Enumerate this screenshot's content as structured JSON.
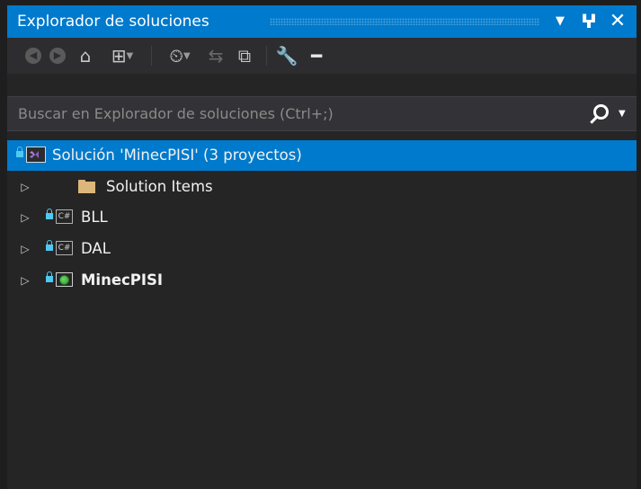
{
  "window": {
    "title": "Explorador de soluciones",
    "dropdown_icon": "caret-down-icon",
    "pin_icon": "pin-icon",
    "close_icon": "close-icon"
  },
  "toolbar": {
    "buttons": [
      {
        "name": "back-button",
        "icon": "back-icon",
        "enabled": false
      },
      {
        "name": "forward-button",
        "icon": "forward-icon",
        "enabled": false
      },
      {
        "name": "home-button",
        "icon": "home-icon",
        "enabled": true
      },
      {
        "name": "switch-views-button",
        "icon": "switch-views-icon",
        "enabled": true,
        "has_dropdown": true
      },
      {
        "name": "pending-changes-filter-button",
        "icon": "pending-changes-icon",
        "enabled": true,
        "has_dropdown": true
      },
      {
        "name": "sync-with-active-document-button",
        "icon": "sync-icon",
        "enabled": false
      },
      {
        "name": "collapse-all-button",
        "icon": "collapse-all-icon",
        "enabled": true
      },
      {
        "name": "properties-button",
        "icon": "wrench-icon",
        "enabled": true
      },
      {
        "name": "preview-selected-items-button",
        "icon": "dash-icon",
        "enabled": true
      }
    ]
  },
  "search": {
    "placeholder": "Buscar en Explorador de soluciones (Ctrl+;)",
    "value": "",
    "icon": "search-icon",
    "options_icon": "caret-down-icon"
  },
  "tree": {
    "solution": {
      "label": "Solución 'MinecPISI'  (3 proyectos)",
      "icon": "solution-icon",
      "selected": true
    },
    "items": [
      {
        "label": "Solution Items",
        "icon": "folder-icon",
        "locked": false,
        "bold": false
      },
      {
        "label": "BLL",
        "icon": "csharp-project-icon",
        "locked": true,
        "bold": false
      },
      {
        "label": "DAL",
        "icon": "csharp-project-icon",
        "locked": true,
        "bold": false
      },
      {
        "label": "MinecPISI",
        "icon": "web-project-icon",
        "locked": true,
        "bold": true
      }
    ]
  },
  "colors": {
    "accent": "#007acc",
    "background": "#252526",
    "toolbar": "#2d2d30",
    "search": "#333337",
    "text": "#f1f1f1",
    "folder": "#dcb67a",
    "lock": "#4ec9f0"
  }
}
